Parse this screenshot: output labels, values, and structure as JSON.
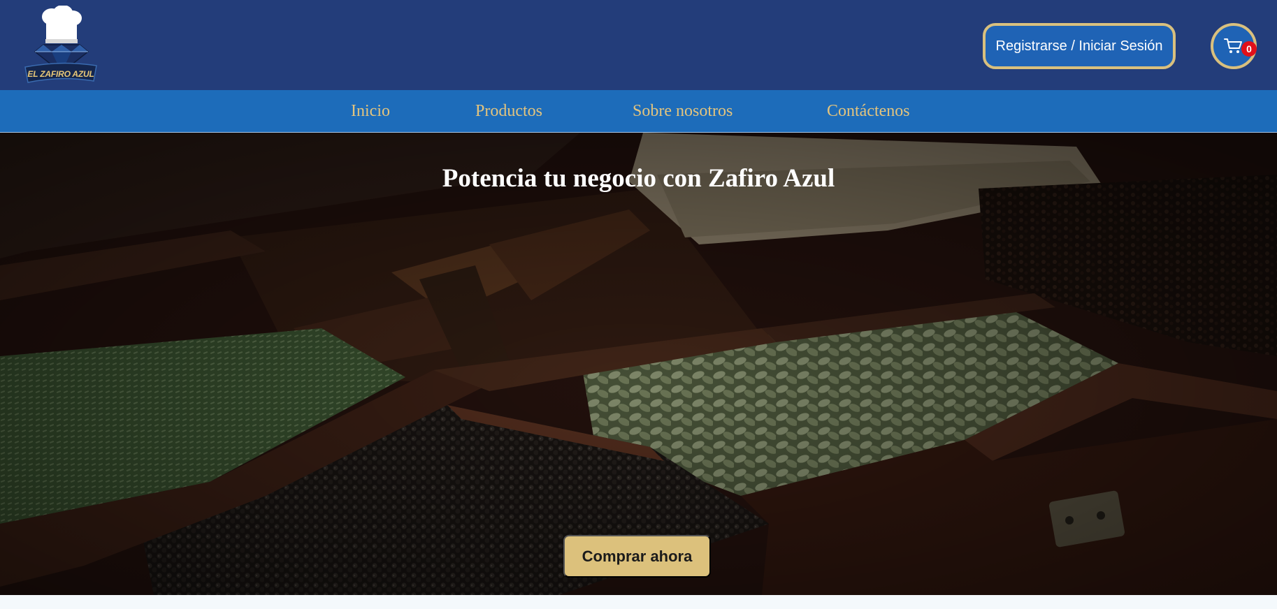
{
  "brand": {
    "name": "EL ZAFIRO AZUL",
    "logo_icon": "chef-hat-diamond-icon"
  },
  "header": {
    "auth_label": "Registrarse / Iniciar Sesión",
    "cart_icon": "shopping-cart-icon",
    "cart_count": "0"
  },
  "nav": {
    "items": [
      {
        "label": "Inicio"
      },
      {
        "label": "Productos"
      },
      {
        "label": "Sobre nosotros"
      },
      {
        "label": "Contáctenos"
      }
    ]
  },
  "hero": {
    "title": "Potencia tu negocio con Zafiro Azul",
    "cta_label": "Comprar ahora"
  },
  "colors": {
    "header_bg": "#233d7a",
    "nav_bg": "#1d6cba",
    "gold": "#dcc17c",
    "badge_red": "#e0101a"
  }
}
